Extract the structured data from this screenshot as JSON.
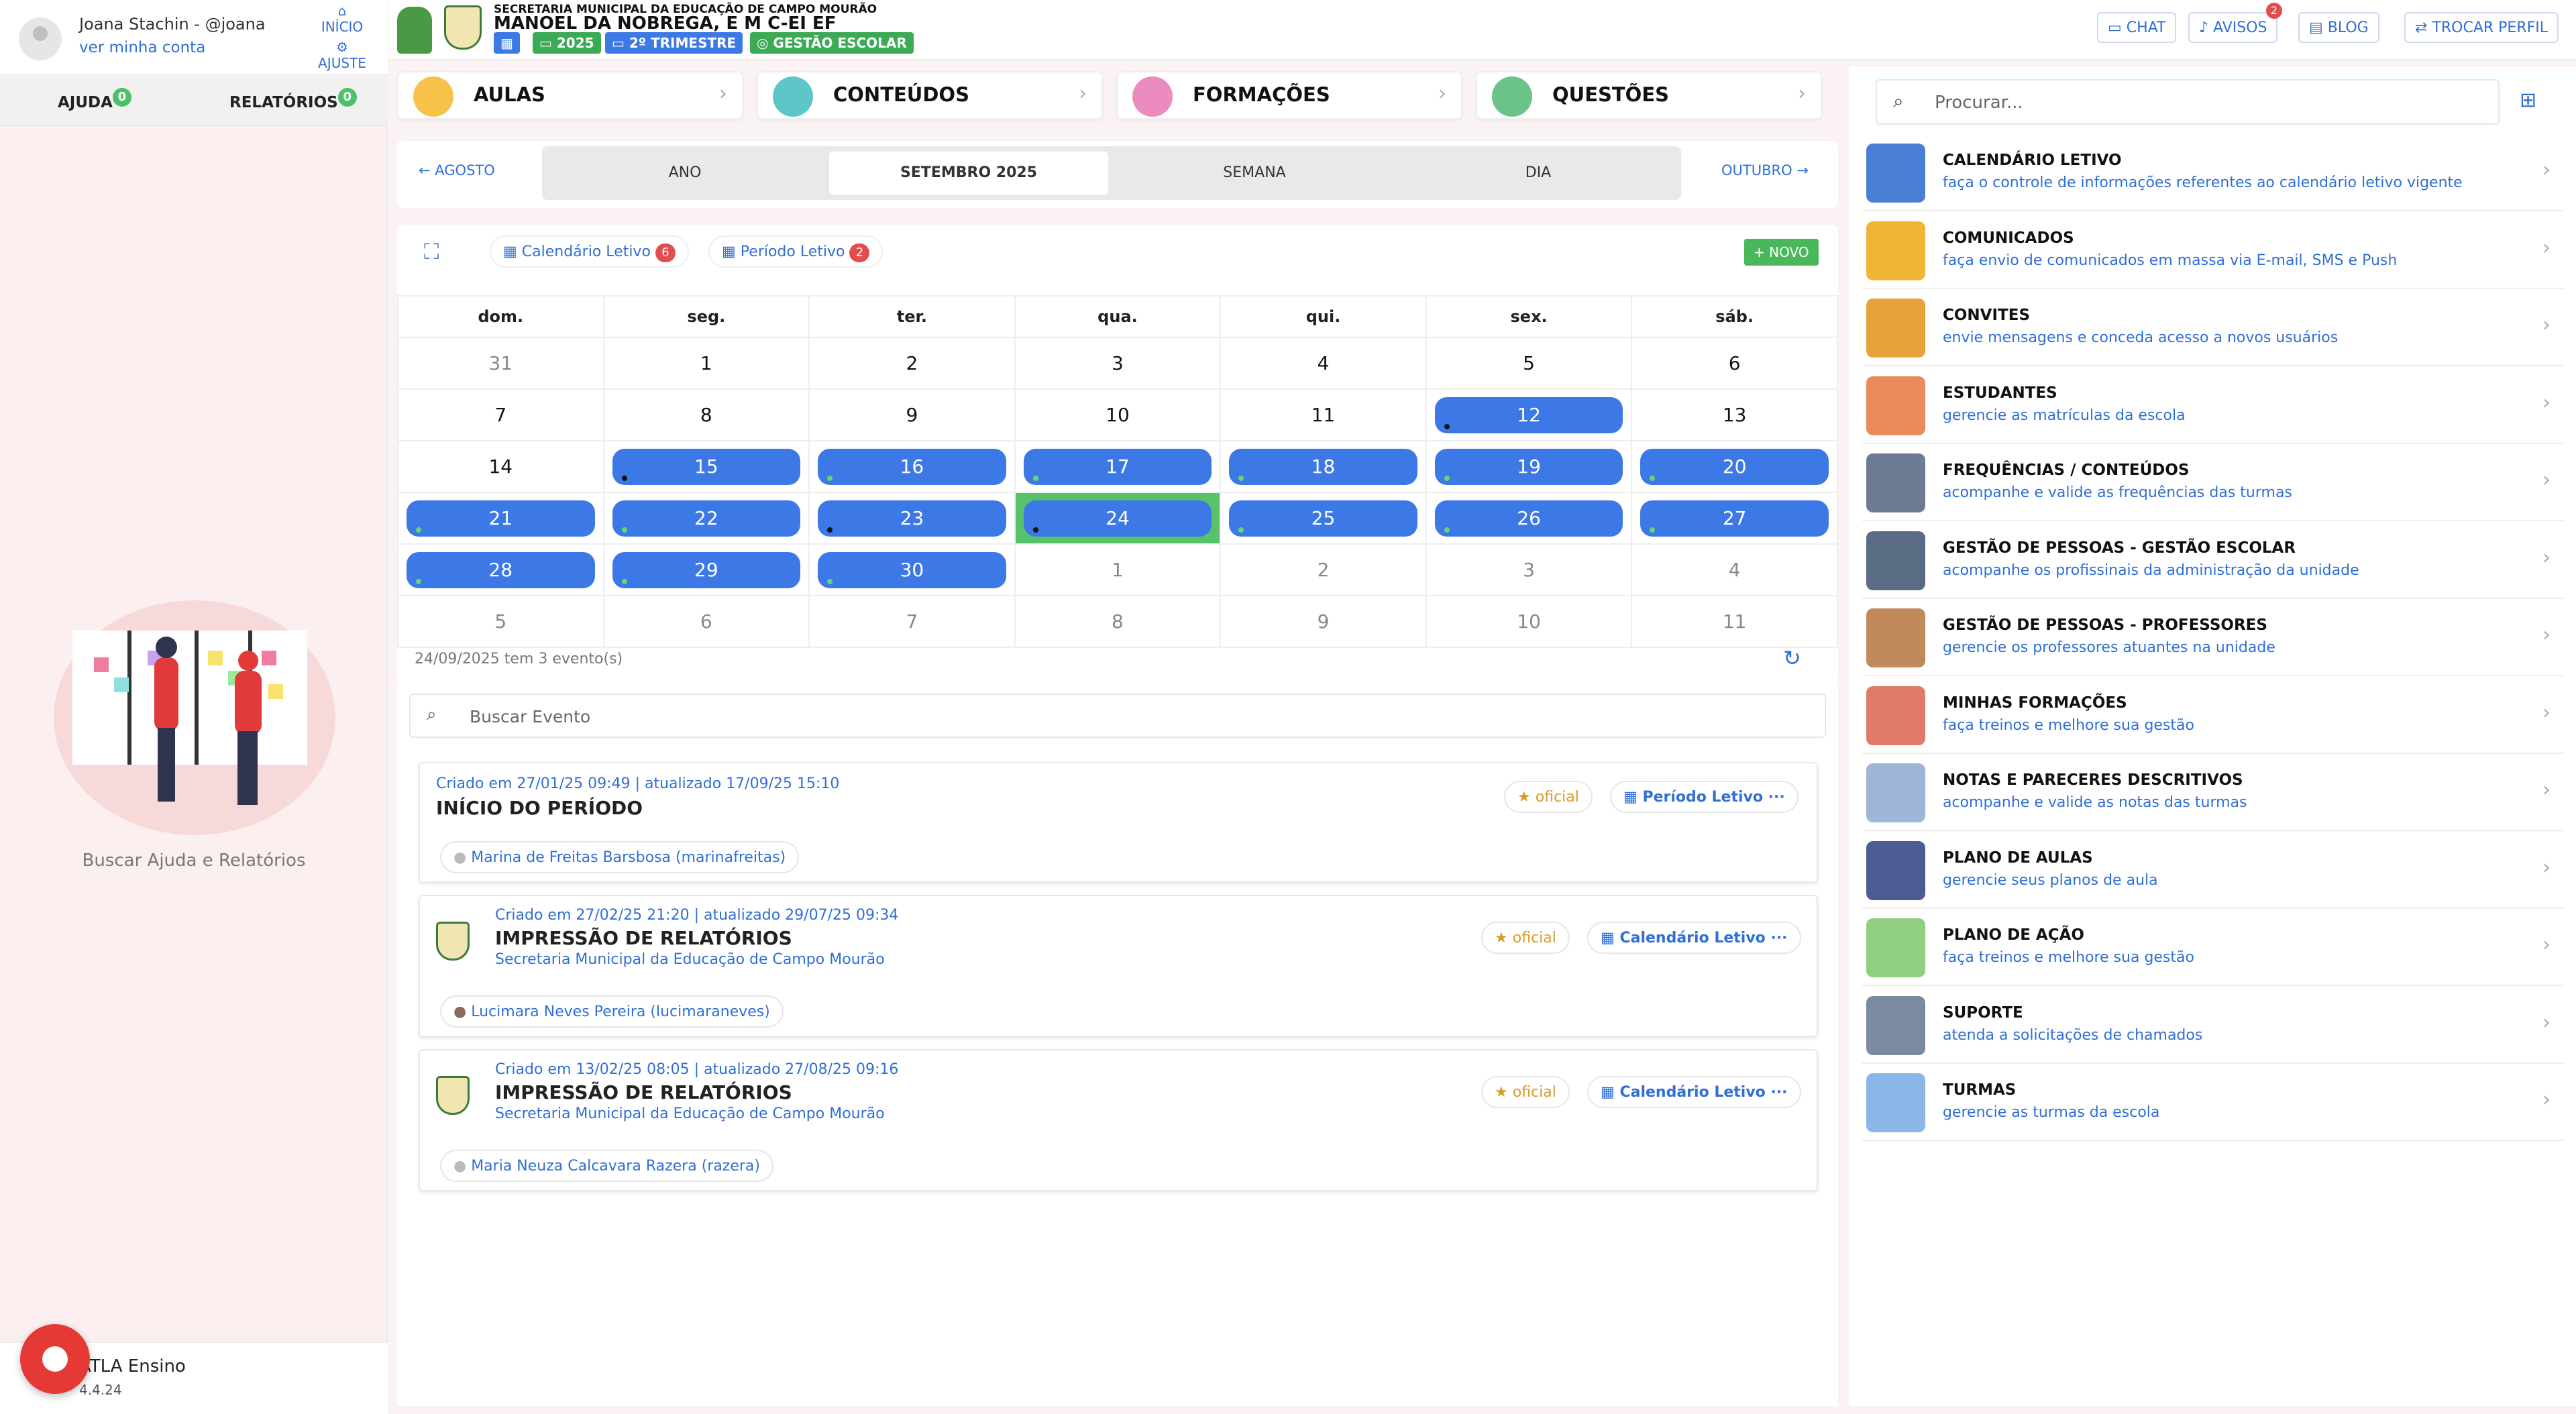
{
  "user": {
    "name": "Joana Stachin - @joana",
    "account_link": "ver minha conta",
    "home": "INÍCIO",
    "settings": "AJUSTE"
  },
  "left_tabs": [
    {
      "label": "AJUDA",
      "count": "0"
    },
    {
      "label": "RELATÓRIOS",
      "count": "0"
    }
  ],
  "help_caption": "Buscar Ajuda e Relatórios",
  "footer": {
    "app": "ATLA Ensino",
    "version": "4.4.24"
  },
  "header": {
    "secretaria": "SECRETARIA MUNICIPAL DA EDUCAÇÃO DE CAMPO MOURÃO",
    "school": "MANOEL DA NOBREGA, E M C-EI EF",
    "year": "2025",
    "trimester": "2º TRIMESTRE",
    "mode": "GESTÃO ESCOLAR",
    "chat": "CHAT",
    "avisos": "AVISOS",
    "avisos_count": "2",
    "blog": "BLOG",
    "trocar": "TROCAR PERFIL"
  },
  "modules": [
    {
      "label": "AULAS"
    },
    {
      "label": "CONTEÚDOS"
    },
    {
      "label": "FORMAÇÕES"
    },
    {
      "label": "QUESTÕES"
    }
  ],
  "calnav": {
    "prev": "AGOSTO",
    "next": "OUTUBRO",
    "views": [
      "ANO",
      "SETEMBRO 2025",
      "SEMANA",
      "DIA"
    ]
  },
  "filters": {
    "calendario": "Calendário Letivo",
    "calendario_count": "6",
    "periodo": "Período Letivo",
    "periodo_count": "2",
    "novo": "NOVO"
  },
  "weekdays": [
    "dom.",
    "seg.",
    "ter.",
    "qua.",
    "qui.",
    "sex.",
    "sáb."
  ],
  "weeks": [
    [
      "31",
      "1",
      "2",
      "3",
      "4",
      "5",
      "6"
    ],
    [
      "7",
      "8",
      "9",
      "10",
      "11",
      "12",
      "13"
    ],
    [
      "14",
      "15",
      "16",
      "17",
      "18",
      "19",
      "20"
    ],
    [
      "21",
      "22",
      "23",
      "24",
      "25",
      "26",
      "27"
    ],
    [
      "28",
      "29",
      "30",
      "1",
      "2",
      "3",
      "4"
    ],
    [
      "5",
      "6",
      "7",
      "8",
      "9",
      "10",
      "11"
    ]
  ],
  "events_summary": "24/09/2025 tem 3 evento(s)",
  "search_event_placeholder": "Buscar Evento",
  "events": [
    {
      "meta": "Criado em 27/01/25 09:49 | atualizado 17/09/25 15:10",
      "title": "INÍCIO DO PERÍODO",
      "org": "",
      "tag": "oficial",
      "type": "Período Letivo",
      "person": "Marina de Freitas Barsbosa (marinafreitas)"
    },
    {
      "meta": "Criado em 27/02/25 21:20 | atualizado 29/07/25 09:34",
      "title": "IMPRESSÃO DE RELATÓRIOS",
      "org": "Secretaria Municipal da Educação de Campo Mourão",
      "tag": "oficial",
      "type": "Calendário Letivo",
      "person": "Lucimara Neves Pereira (lucimaraneves)"
    },
    {
      "meta": "Criado em 13/02/25 08:05 | atualizado 27/08/25 09:16",
      "title": "IMPRESSÃO DE RELATÓRIOS",
      "org": "Secretaria Municipal da Educação de Campo Mourão",
      "tag": "oficial",
      "type": "Calendário Letivo",
      "person": "Maria Neuza Calcavara Razera (razera)"
    }
  ],
  "search_placeholder": "Procurar...",
  "menu": [
    {
      "title": "CALENDÁRIO LETIVO",
      "sub": "faça o controle de informações referentes ao calendário letivo vigente",
      "color": "#4a7fd6"
    },
    {
      "title": "COMUNICADOS",
      "sub": "faça envio de comunicados em massa via E-mail, SMS e Push",
      "color": "#f2b437"
    },
    {
      "title": "CONVITES",
      "sub": "envie mensagens e conceda acesso a novos usuários",
      "color": "#e8a23a"
    },
    {
      "title": "ESTUDANTES",
      "sub": "gerencie as matrículas da escola",
      "color": "#e98b5a"
    },
    {
      "title": "FREQUÊNCIAS / CONTEÚDOS",
      "sub": "acompanhe e valide as frequências das turmas",
      "color": "#6d7c94"
    },
    {
      "title": "GESTÃO DE PESSOAS - GESTÃO ESCOLAR",
      "sub": "acompanhe os profissinais da administração da unidade",
      "color": "#5a6b84"
    },
    {
      "title": "GESTÃO DE PESSOAS - PROFESSORES",
      "sub": "gerencie os professores atuantes na unidade",
      "color": "#c08a5a"
    },
    {
      "title": "MINHAS FORMAÇÕES",
      "sub": "faça treinos e melhore sua gestão",
      "color": "#e07a6a"
    },
    {
      "title": "NOTAS E PARECERES DESCRITIVOS",
      "sub": "acompanhe e valide as notas das turmas",
      "color": "#9db6d8"
    },
    {
      "title": "PLANO DE AULAS",
      "sub": "gerencie seus planos de aula",
      "color": "#4b5d92"
    },
    {
      "title": "PLANO DE AÇÃO",
      "sub": "faça treinos e melhore sua gestão",
      "color": "#8fcf7f"
    },
    {
      "title": "SUPORTE",
      "sub": "atenda a solicitações de chamados",
      "color": "#7a8aa0"
    },
    {
      "title": "TURMAS",
      "sub": "gerencie as turmas da escola",
      "color": "#8bb6e8"
    }
  ]
}
